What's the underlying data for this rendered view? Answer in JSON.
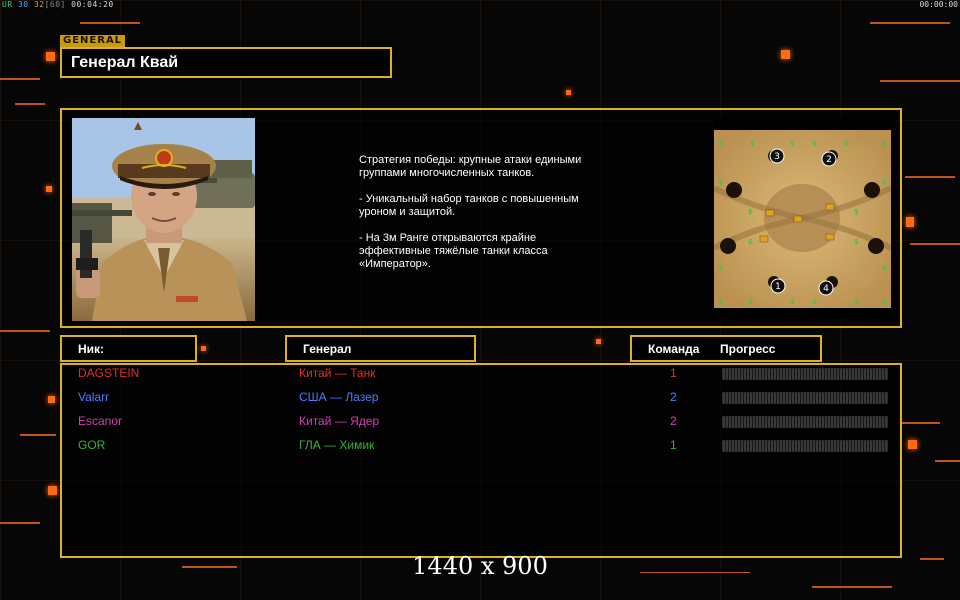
{
  "topbar": {
    "fps_a": "UR",
    "fps_b": "30",
    "fps_c": "32",
    "fps_d": "[60]",
    "elapsed": "00:04:20",
    "timer": "00:00:00"
  },
  "header": {
    "tag": "GENERAL",
    "title": "Генерал Квай"
  },
  "description": [
    "Стратегия победы: крупные атаки едиными\n группами многочисленных танков.",
    "- Уникальный набор танков с повышенным\n уроном и защитой.",
    "- На 3м Ранге открываются крайне\n эффективные тяжёлые танки класса\n «Император»."
  ],
  "minimap": {
    "start_labels": [
      "1",
      "2",
      "3",
      "4"
    ]
  },
  "columns": {
    "nick": "Ник:",
    "general": "Генерал",
    "team": "Команда",
    "progress": "Прогресс"
  },
  "players": [
    {
      "nick": "DAGSTEIN",
      "general": "Китай — Танк",
      "team": "1",
      "color": "#e0302a"
    },
    {
      "nick": "Valarr",
      "general": "США — Лазер",
      "team": "2",
      "color": "#4f7bff"
    },
    {
      "nick": "Escanor",
      "general": "Китай — Ядер",
      "team": "2",
      "color": "#d43fb4"
    },
    {
      "nick": "GOR",
      "general": "ГЛА — Химик",
      "team": "1",
      "color": "#35b335"
    }
  ],
  "footer": {
    "resolution": "1440 x 900"
  },
  "colors": {
    "accent": "#e0b21a",
    "background": "#060606"
  }
}
